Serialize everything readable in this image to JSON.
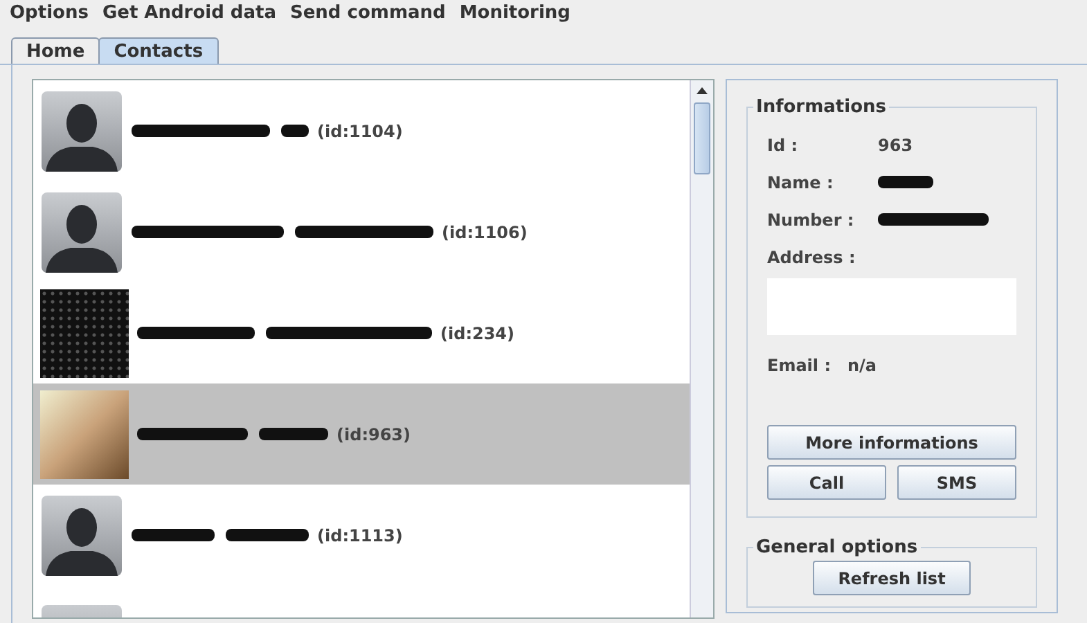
{
  "menu": [
    "Options",
    "Get Android data",
    "Send command",
    "Monitoring"
  ],
  "tabs": [
    {
      "label": "Home",
      "selected": false
    },
    {
      "label": "Contacts",
      "selected": true
    }
  ],
  "contacts": [
    {
      "kind": "silhouette",
      "id": "(id:1104)",
      "selected": false
    },
    {
      "kind": "silhouette",
      "id": "(id:1106)",
      "selected": false
    },
    {
      "kind": "redacted",
      "id": "(id:234)",
      "selected": false
    },
    {
      "kind": "photo",
      "id": "(id:963)",
      "selected": true
    },
    {
      "kind": "silhouette",
      "id": "(id:1113)",
      "selected": false
    },
    {
      "kind": "silhouette",
      "selected": false
    }
  ],
  "informations": {
    "title": "Informations",
    "id_label": "Id :",
    "id_value": "963",
    "name_label": "Name :",
    "number_label": "Number :",
    "address_label": "Address :",
    "email_label": "Email :",
    "email_value": "n/a",
    "buttons": [
      "More informations",
      "Call",
      "SMS"
    ]
  },
  "general_options": {
    "title": "General options",
    "buttons": [
      "Refresh list"
    ]
  }
}
